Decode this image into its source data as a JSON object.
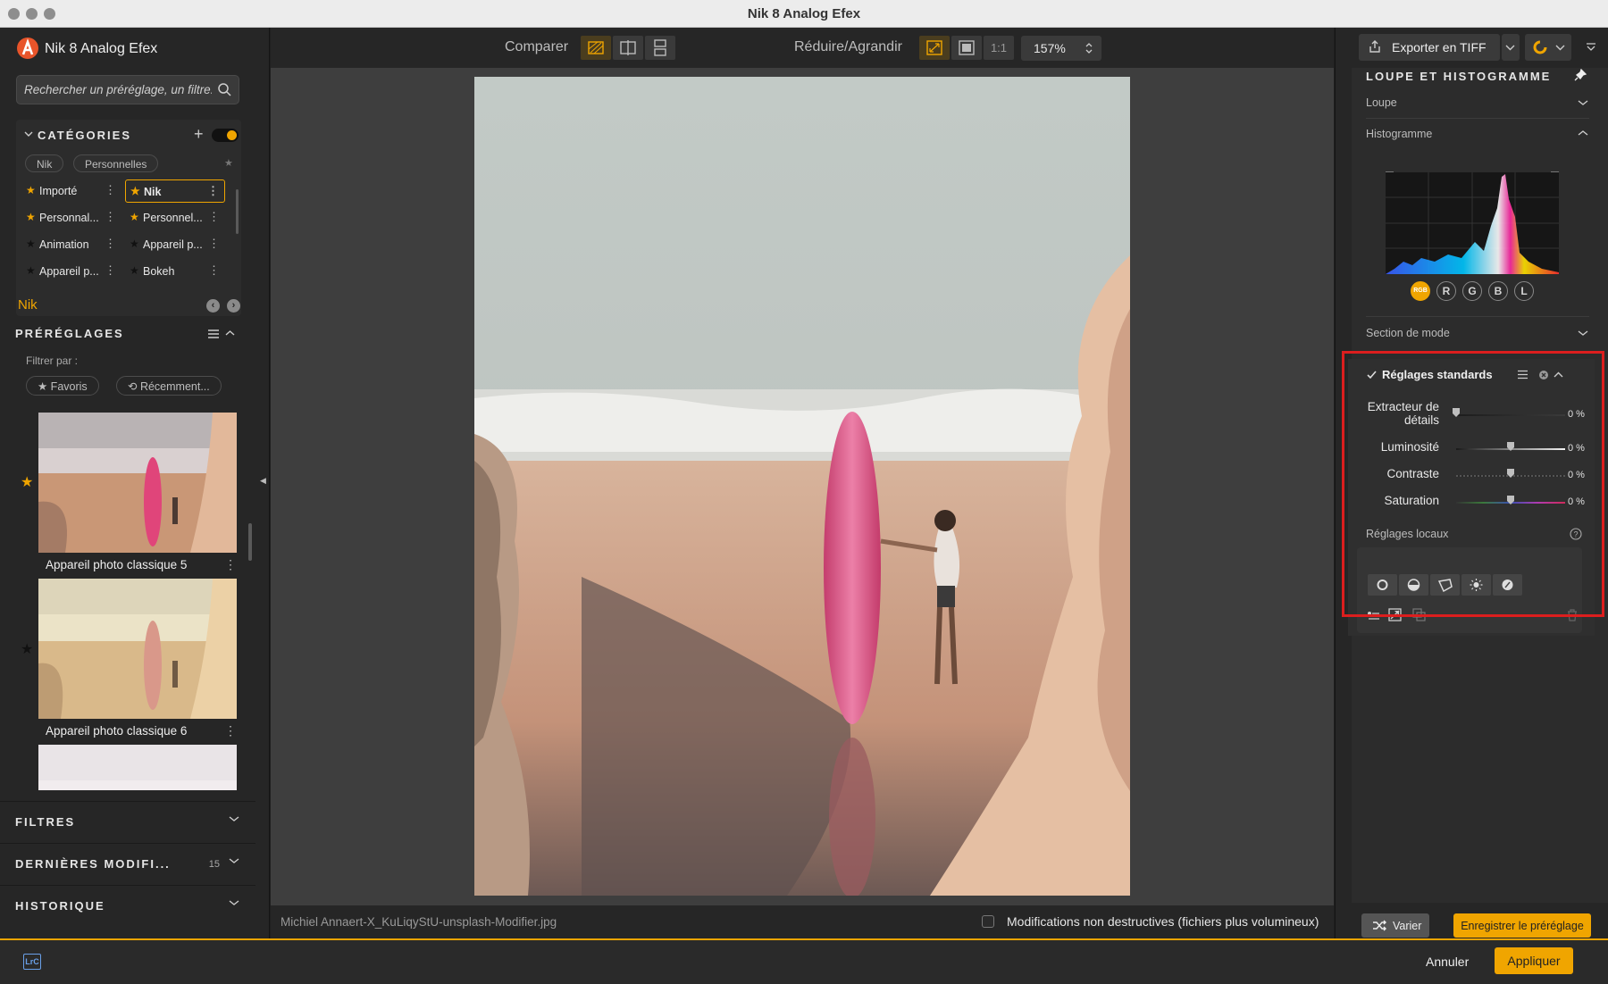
{
  "window": {
    "title": "Nik 8 Analog Efex"
  },
  "left": {
    "app_title": "Nik 8 Analog Efex",
    "search_placeholder": "Rechercher un préréglage, un filtre...",
    "categories": {
      "title": "CATÉGORIES",
      "chips": [
        "Nik",
        "Personnelles"
      ],
      "items": [
        {
          "label": "Importé",
          "starred": true
        },
        {
          "label": "Nik",
          "starred": true,
          "active": true
        },
        {
          "label": "Personnal...",
          "starred": true
        },
        {
          "label": "Personnel...",
          "starred": true
        },
        {
          "label": "Animation",
          "starred": false
        },
        {
          "label": "Appareil p...",
          "starred": false
        },
        {
          "label": "Appareil p...",
          "starred": false
        },
        {
          "label": "Bokeh",
          "starred": false
        }
      ]
    },
    "group_label": "Nik",
    "presets": {
      "title": "PRÉRÉGLAGES",
      "filter_label": "Filtrer par :",
      "filter_chips": [
        "★ Favoris",
        "⟲ Récemment..."
      ],
      "items": [
        {
          "label": "Appareil photo classique 5",
          "starred": true
        },
        {
          "label": "Appareil photo classique 6",
          "starred": false
        }
      ]
    },
    "sections": [
      {
        "label": "FILTRES",
        "count": ""
      },
      {
        "label": "DERNIÈRES MODIFI...",
        "count": "15"
      },
      {
        "label": "HISTORIQUE",
        "count": ""
      }
    ]
  },
  "toolbar": {
    "compare_label": "Comparer",
    "zoom_label": "Réduire/Agrandir",
    "one_to_one": "1:1",
    "zoom_value": "157%"
  },
  "canvas": {
    "filename": "Michiel Annaert-X_KuLiqyStU-unsplash-Modifier.jpg",
    "nondestructive_label": "Modifications non destructives (fichiers plus volumineux)"
  },
  "right": {
    "export_label": "Exporter en TIFF",
    "panel_title": "LOUPE ET HISTOGRAMME",
    "loupe_label": "Loupe",
    "histogram_label": "Histogramme",
    "channels": [
      "RGB",
      "R",
      "G",
      "B",
      "L"
    ],
    "mode_label": "Section de mode",
    "standard": {
      "title": "Réglages standards",
      "sliders": [
        {
          "label": "Extracteur de détails",
          "value": "0 %"
        },
        {
          "label": "Luminosité",
          "value": "0 %"
        },
        {
          "label": "Contraste",
          "value": "0 %"
        },
        {
          "label": "Saturation",
          "value": "0 %"
        }
      ]
    },
    "local_label": "Réglages locaux",
    "varier_label": "Varier",
    "save_preset_label": "Enregistrer le préréglage"
  },
  "bottom": {
    "lrc": "LrC",
    "cancel_label": "Annuler",
    "apply_label": "Appliquer"
  },
  "colors": {
    "accent": "#f0a500",
    "highlight_frame": "#dc1e1e"
  }
}
